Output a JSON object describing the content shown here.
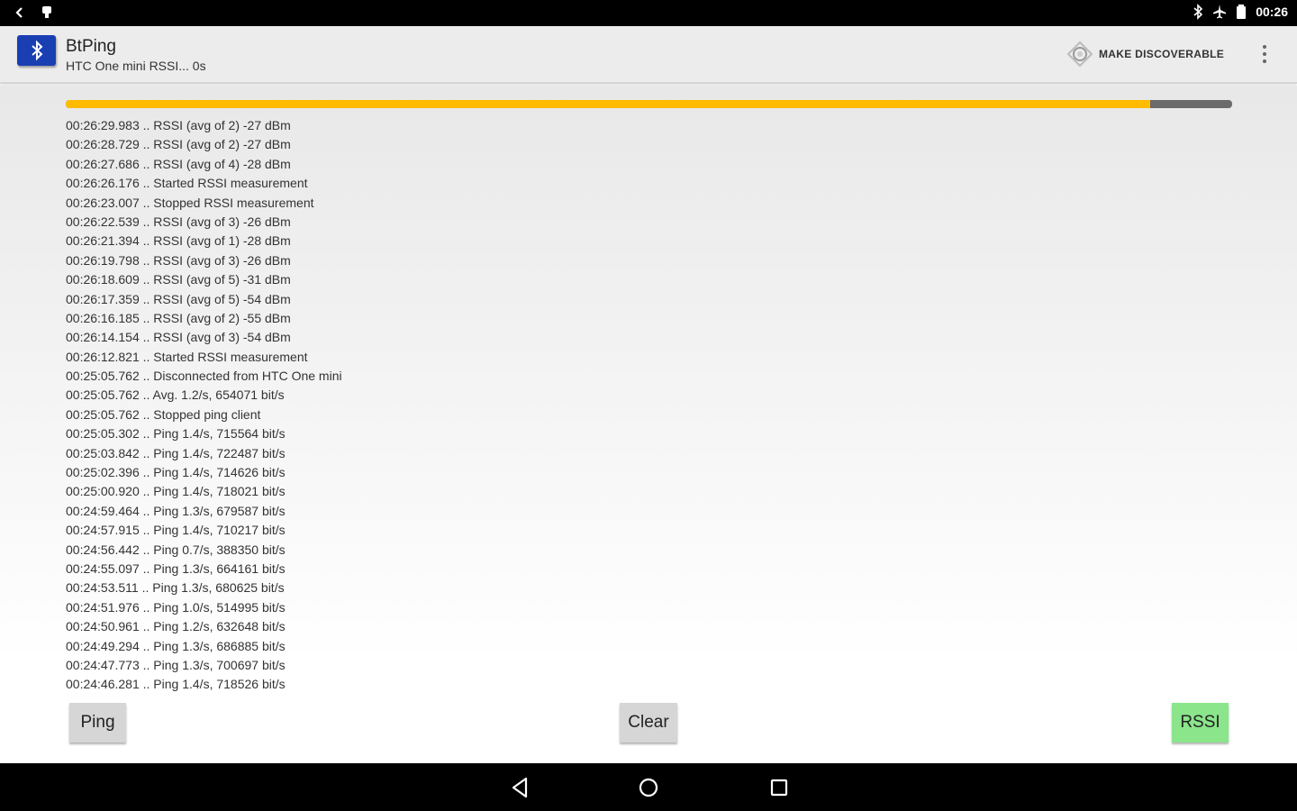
{
  "status_bar": {
    "time": "00:26",
    "left_icons": [
      "back-arrow-icon",
      "notification-icon"
    ],
    "right_icons": [
      "bluetooth-icon",
      "airplane-mode-icon",
      "battery-icon"
    ]
  },
  "action_bar": {
    "app_icon": "bluetooth-icon",
    "title": "BtPing",
    "subtitle": "HTC One mini RSSI... 0s",
    "discoverable_label": "MAKE DISCOVERABLE",
    "overflow_icon": "overflow-menu-icon"
  },
  "progress": {
    "value_fraction": 0.93,
    "fill_color": "#ffbb00",
    "track_color": "#6b6b6b"
  },
  "log": [
    "00:26:29.983 .. RSSI (avg of 2) -27 dBm",
    "00:26:28.729 .. RSSI (avg of 2) -27 dBm",
    "00:26:27.686 .. RSSI (avg of 4) -28 dBm",
    "00:26:26.176 .. Started RSSI measurement",
    "00:26:23.007 .. Stopped RSSI measurement",
    "00:26:22.539 .. RSSI (avg of 3) -26 dBm",
    "00:26:21.394 .. RSSI (avg of 1) -28 dBm",
    "00:26:19.798 .. RSSI (avg of 3) -26 dBm",
    "00:26:18.609 .. RSSI (avg of 5) -31 dBm",
    "00:26:17.359 .. RSSI (avg of 5) -54 dBm",
    "00:26:16.185 .. RSSI (avg of 2) -55 dBm",
    "00:26:14.154 .. RSSI (avg of 3) -54 dBm",
    "00:26:12.821 .. Started RSSI measurement",
    "00:25:05.762 .. Disconnected from HTC One mini",
    "00:25:05.762 .. Avg. 1.2/s, 654071 bit/s",
    "00:25:05.762 .. Stopped ping client",
    "00:25:05.302 .. Ping 1.4/s, 715564 bit/s",
    "00:25:03.842 .. Ping 1.4/s, 722487 bit/s",
    "00:25:02.396 .. Ping 1.4/s, 714626 bit/s",
    "00:25:00.920 .. Ping 1.4/s, 718021 bit/s",
    "00:24:59.464 .. Ping 1.3/s, 679587 bit/s",
    "00:24:57.915 .. Ping 1.4/s, 710217 bit/s",
    "00:24:56.442 .. Ping 0.7/s, 388350 bit/s",
    "00:24:55.097 .. Ping 1.3/s, 664161 bit/s",
    "00:24:53.511 .. Ping 1.3/s, 680625 bit/s",
    "00:24:51.976 .. Ping 1.0/s, 514995 bit/s",
    "00:24:50.961 .. Ping 1.2/s, 632648 bit/s",
    "00:24:49.294 .. Ping 1.3/s, 686885 bit/s",
    "00:24:47.773 .. Ping 1.3/s, 700697 bit/s",
    "00:24:46.281 .. Ping 1.4/s, 718526 bit/s"
  ],
  "buttons": {
    "ping": "Ping",
    "clear": "Clear",
    "rssi": "RSSI",
    "rssi_color": "#8be58b"
  },
  "nav_bar": {
    "icons": [
      "nav-back-icon",
      "nav-home-icon",
      "nav-recents-icon"
    ]
  }
}
